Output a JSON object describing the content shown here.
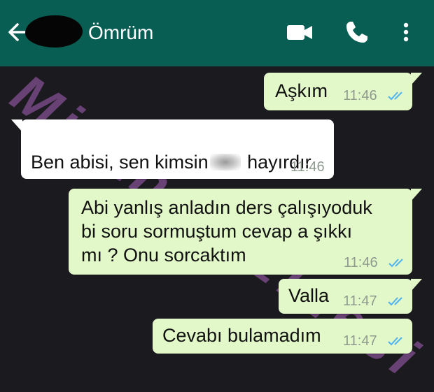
{
  "header": {
    "contact_name": "Ömrüm",
    "icons": [
      "back-arrow-icon",
      "video-call-icon",
      "phone-icon",
      "more-options-icon"
    ],
    "color": "#095e54"
  },
  "messages": [
    {
      "text": "Aşkım",
      "time": "11:46",
      "direction": "outgoing",
      "ticks": "blue-double"
    },
    {
      "text_before": "Ben abisi, sen kimsin",
      "text_after": "hayırdır",
      "time": "11:46",
      "direction": "incoming"
    },
    {
      "text": "Abi yanlış anladın ders çalışıyoduk\nbi soru sormuştum cevap a şıkkı\nmı ? Onu sorcaktım",
      "time": "11:46",
      "direction": "outgoing",
      "ticks": "blue-double"
    },
    {
      "text": "Valla",
      "time": "11:47",
      "direction": "outgoing",
      "ticks": "blue-double"
    },
    {
      "text": "Cevabı bulamadım",
      "time": "11:47",
      "direction": "outgoing",
      "ticks": "blue-double"
    }
  ],
  "watermark": "Mizah Hazinesi",
  "colors": {
    "outgoing_bubble": "#e2f8c8",
    "incoming_bubble": "#ffffff",
    "chat_background": "#1b1b1f",
    "read_ticks": "#4fb3f0"
  }
}
